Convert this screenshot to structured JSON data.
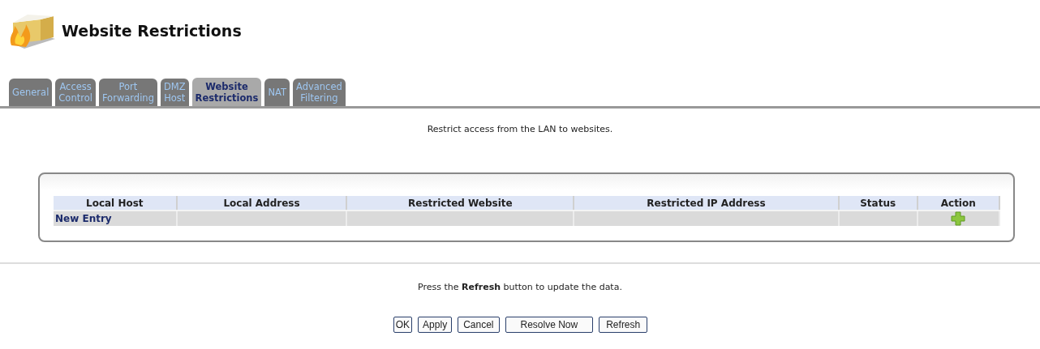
{
  "page": {
    "title": "Website Restrictions"
  },
  "tabs": [
    {
      "label": [
        "General"
      ],
      "selected": false
    },
    {
      "label": [
        "Access",
        "Control"
      ],
      "selected": false
    },
    {
      "label": [
        "Port",
        "Forwarding"
      ],
      "selected": false
    },
    {
      "label": [
        "DMZ",
        "Host"
      ],
      "selected": false
    },
    {
      "label": [
        "Website",
        "Restrictions"
      ],
      "selected": true
    },
    {
      "label": [
        "NAT"
      ],
      "selected": false
    },
    {
      "label": [
        "Advanced",
        "Filtering"
      ],
      "selected": false
    }
  ],
  "intro": "Restrict access from the LAN to websites.",
  "table": {
    "columns": [
      "Local Host",
      "Local Address",
      "Restricted Website",
      "Restricted IP Address",
      "Status",
      "Action"
    ],
    "rows": [
      {
        "link": "New Entry",
        "kind": "add"
      }
    ]
  },
  "note": "Press the **Refresh** button to update the data.",
  "buttons": [
    "OK",
    "Apply",
    "Cancel",
    "Resolve Now",
    "Refresh"
  ]
}
